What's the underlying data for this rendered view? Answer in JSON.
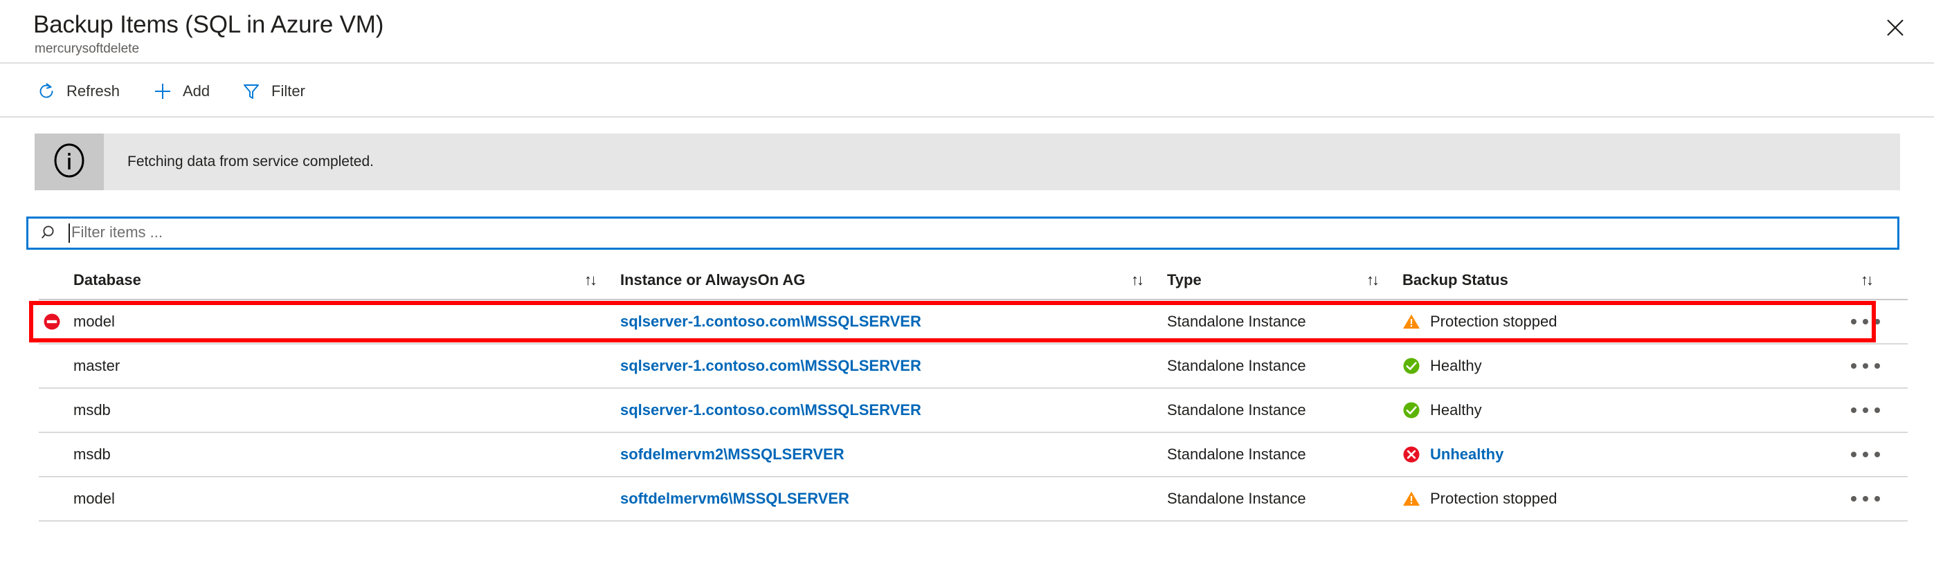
{
  "header": {
    "title": "Backup Items (SQL in Azure VM)",
    "subtitle": "mercurysoftdelete",
    "close_label": "Close",
    "close_icon": "close-icon"
  },
  "toolbar": {
    "refresh_label": "Refresh",
    "refresh_icon": "refresh-icon",
    "add_label": "Add",
    "add_icon": "plus-icon",
    "filter_label": "Filter",
    "filter_icon": "funnel-icon"
  },
  "banner": {
    "icon": "info-icon",
    "message": "Fetching data from service completed."
  },
  "search": {
    "icon": "search-icon",
    "placeholder": "Filter items ...",
    "value": ""
  },
  "table": {
    "sort_icon": "sort-ascending-descending-icon",
    "columns": [
      {
        "key": "database",
        "label": "Database",
        "sortable": true
      },
      {
        "key": "instance",
        "label": "Instance or AlwaysOn AG",
        "sortable": true
      },
      {
        "key": "type",
        "label": "Type",
        "sortable": true
      },
      {
        "key": "status",
        "label": "Backup Status",
        "sortable": true
      }
    ],
    "context_menu_icon": "ellipsis-icon",
    "rows": [
      {
        "state_icon": "stop-protection-icon",
        "database": "model",
        "instance": "sqlserver-1.contoso.com\\MSSQLSERVER",
        "type": "Standalone Instance",
        "status": "Protection stopped",
        "status_icon": "warning-icon",
        "status_is_link": false,
        "highlighted": true
      },
      {
        "state_icon": "",
        "database": "master",
        "instance": "sqlserver-1.contoso.com\\MSSQLSERVER",
        "type": "Standalone Instance",
        "status": "Healthy",
        "status_icon": "success-icon",
        "status_is_link": false,
        "highlighted": false
      },
      {
        "state_icon": "",
        "database": "msdb",
        "instance": "sqlserver-1.contoso.com\\MSSQLSERVER",
        "type": "Standalone Instance",
        "status": "Healthy",
        "status_icon": "success-icon",
        "status_is_link": false,
        "highlighted": false
      },
      {
        "state_icon": "",
        "database": "msdb",
        "instance": "sofdelmervm2\\MSSQLSERVER",
        "type": "Standalone Instance",
        "status": "Unhealthy",
        "status_icon": "error-icon",
        "status_is_link": true,
        "highlighted": false
      },
      {
        "state_icon": "",
        "database": "model",
        "instance": "softdelmervm6\\MSSQLSERVER",
        "type": "Standalone Instance",
        "status": "Protection stopped",
        "status_icon": "warning-icon",
        "status_is_link": false,
        "highlighted": false
      }
    ]
  },
  "colors": {
    "accent_blue": "#0078d4",
    "link_blue": "#0067b8",
    "warning_orange": "#ff8c00",
    "error_red": "#e81123",
    "success_green": "#5cb300",
    "highlight_red": "#ff0000",
    "banner_bg": "#e6e6e6",
    "banner_icon_bg": "#c8c8c8"
  }
}
